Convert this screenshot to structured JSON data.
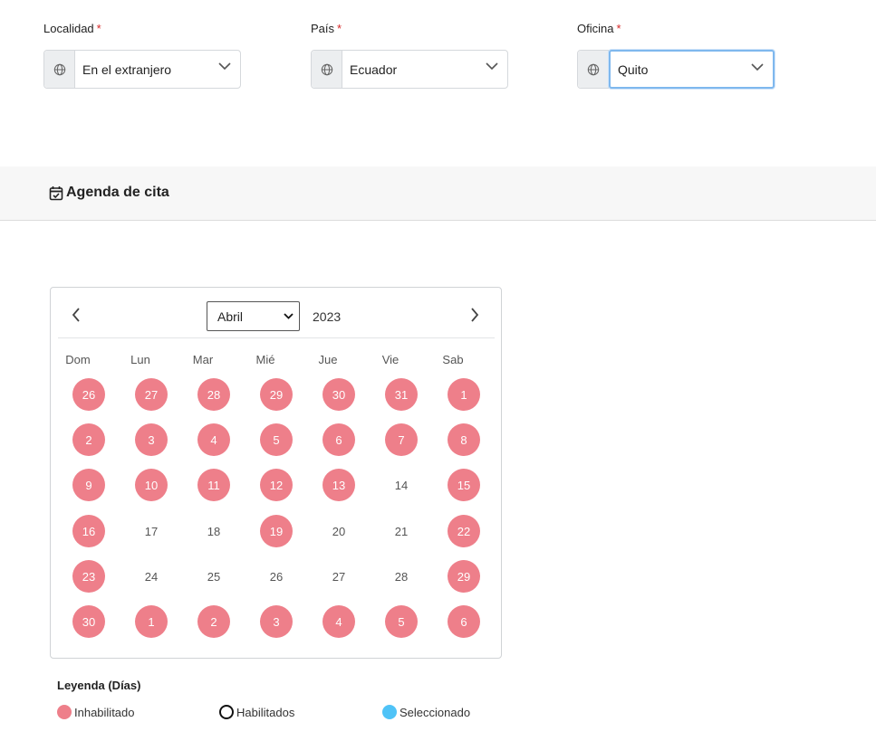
{
  "fields": {
    "localidad": {
      "label": "Localidad",
      "value": "En el extranjero"
    },
    "pais": {
      "label": "País",
      "value": "Ecuador"
    },
    "oficina": {
      "label": "Oficina",
      "value": "Quito"
    },
    "required_mark": "*"
  },
  "section": {
    "title": "Agenda de cita"
  },
  "calendar": {
    "month": "Abril",
    "year": "2023",
    "weekdays": [
      "Dom",
      "Lun",
      "Mar",
      "Mié",
      "Jue",
      "Vie",
      "Sab"
    ],
    "weeks": [
      [
        {
          "d": "26",
          "s": "off"
        },
        {
          "d": "27",
          "s": "off"
        },
        {
          "d": "28",
          "s": "off"
        },
        {
          "d": "29",
          "s": "off"
        },
        {
          "d": "30",
          "s": "off"
        },
        {
          "d": "31",
          "s": "off"
        },
        {
          "d": "1",
          "s": "off"
        }
      ],
      [
        {
          "d": "2",
          "s": "off"
        },
        {
          "d": "3",
          "s": "off"
        },
        {
          "d": "4",
          "s": "off"
        },
        {
          "d": "5",
          "s": "off"
        },
        {
          "d": "6",
          "s": "off"
        },
        {
          "d": "7",
          "s": "off"
        },
        {
          "d": "8",
          "s": "off"
        }
      ],
      [
        {
          "d": "9",
          "s": "off"
        },
        {
          "d": "10",
          "s": "off"
        },
        {
          "d": "11",
          "s": "off"
        },
        {
          "d": "12",
          "s": "off"
        },
        {
          "d": "13",
          "s": "off"
        },
        {
          "d": "14",
          "s": "on"
        },
        {
          "d": "15",
          "s": "off"
        }
      ],
      [
        {
          "d": "16",
          "s": "off"
        },
        {
          "d": "17",
          "s": "on"
        },
        {
          "d": "18",
          "s": "on"
        },
        {
          "d": "19",
          "s": "off"
        },
        {
          "d": "20",
          "s": "on"
        },
        {
          "d": "21",
          "s": "on"
        },
        {
          "d": "22",
          "s": "off"
        }
      ],
      [
        {
          "d": "23",
          "s": "off"
        },
        {
          "d": "24",
          "s": "on"
        },
        {
          "d": "25",
          "s": "on"
        },
        {
          "d": "26",
          "s": "on"
        },
        {
          "d": "27",
          "s": "on"
        },
        {
          "d": "28",
          "s": "on"
        },
        {
          "d": "29",
          "s": "off"
        }
      ],
      [
        {
          "d": "30",
          "s": "off"
        },
        {
          "d": "1",
          "s": "off"
        },
        {
          "d": "2",
          "s": "off"
        },
        {
          "d": "3",
          "s": "off"
        },
        {
          "d": "4",
          "s": "off"
        },
        {
          "d": "5",
          "s": "off"
        },
        {
          "d": "6",
          "s": "off"
        }
      ]
    ]
  },
  "legend": {
    "title": "Leyenda (Días)",
    "items": [
      {
        "label": "Inhabilitado",
        "color": "#ee7f8a"
      },
      {
        "label": "Habilitados",
        "color": "#ffffff"
      },
      {
        "label": "Seleccionado",
        "color": "#4fc3f7"
      }
    ]
  },
  "icons": {
    "field_addon": "globe-icon",
    "section": "calendar-check-icon"
  }
}
